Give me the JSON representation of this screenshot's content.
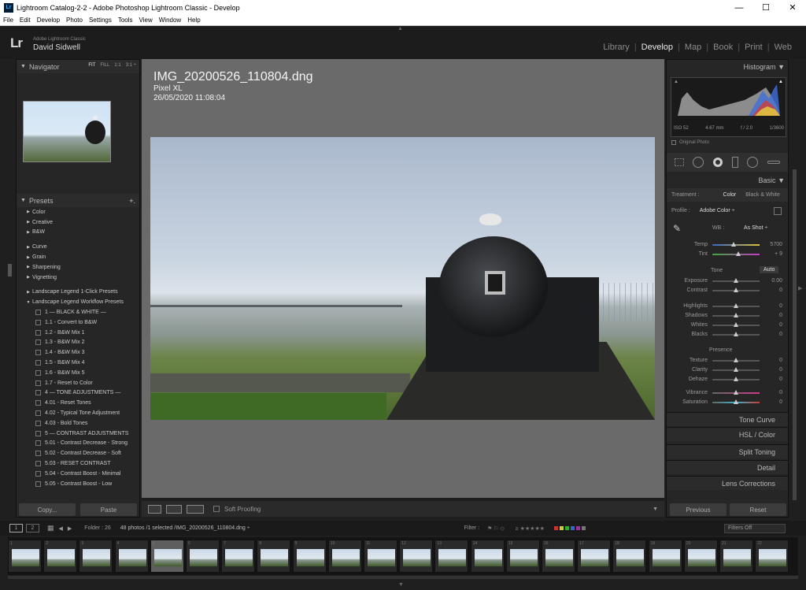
{
  "window": {
    "title": "Lightroom Catalog-2-2 - Adobe Photoshop Lightroom Classic - Develop",
    "app_icon": "Lr"
  },
  "menu": [
    "File",
    "Edit",
    "Develop",
    "Photo",
    "Settings",
    "Tools",
    "View",
    "Window",
    "Help"
  ],
  "identity": {
    "logo": "Lr",
    "product": "Adobe Lightroom Classic",
    "user": "David Sidwell"
  },
  "modules": [
    "Library",
    "Develop",
    "Map",
    "Book",
    "Print",
    "Web"
  ],
  "active_module": "Develop",
  "navigator": {
    "title": "Navigator",
    "zoom": [
      "FIT",
      "FILL",
      "1:1",
      "3:1 ÷"
    ]
  },
  "presets": {
    "title": "Presets",
    "add": "+.",
    "groups_top": [
      "Color",
      "Creative",
      "B&W"
    ],
    "groups_mid": [
      "Curve",
      "Grain",
      "Sharpening",
      "Vignetting"
    ],
    "groups_bottom": [
      "Landscape Legend 1-Click Presets",
      "Landscape Legend Workflow Presets"
    ],
    "items": [
      "1 — BLACK & WHITE —",
      "1.1 - Convert to B&W",
      "1.2 - B&W Mix 1",
      "1.3 - B&W Mix 2",
      "1.4 - B&W Mix 3",
      "1.5 - B&W Mix 4",
      "1.6 - B&W Mix 5",
      "1.7 - Reset to Color",
      "4 — TONE ADJUSTMENTS —",
      "4.01 - Reset Tones",
      "4.02 - Typical Tone Adjustment",
      "4.03 - Bold Tones",
      "5 — CONTRAST ADJUSTMENTS",
      "5.01 - Contrast Decrease - Strong",
      "5.02 - Contrast Decrease - Soft",
      "5.03 - RESET CONTRAST",
      "5.04 - Contrast Boost - Minimal",
      "5.05 - Contrast Boost - Low"
    ]
  },
  "left_buttons": {
    "copy": "Copy...",
    "paste": "Paste"
  },
  "photo_info": {
    "filename": "IMG_20200526_110804.dng",
    "camera": "Pixel XL",
    "datetime": "26/05/2020 11:08:04"
  },
  "toolbar": {
    "soft_proofing": "Soft Proofing"
  },
  "histogram": {
    "title": "Histogram",
    "iso": "ISO 52",
    "focal": "4.67 mm",
    "aperture": "f / 2.0",
    "shutter": "1/3600",
    "original_photo": "Original Photo"
  },
  "basic": {
    "title": "Basic",
    "treatment_label": "Treatment :",
    "treatment_color": "Color",
    "treatment_bw": "Black & White",
    "profile_label": "Profile :",
    "profile_value": "Adobe Color ÷",
    "wb_label": "WB :",
    "wb_value": "As Shot ÷",
    "tone_label": "Tone",
    "auto": "Auto",
    "presence_label": "Presence",
    "sliders": [
      {
        "label": "Temp",
        "value": "5700",
        "pos": 0.45
      },
      {
        "label": "Tint",
        "value": "+ 9",
        "pos": 0.55
      },
      {
        "label": "Exposure",
        "value": "0.00",
        "pos": 0.5
      },
      {
        "label": "Contrast",
        "value": "0",
        "pos": 0.5
      },
      {
        "label": "Highlights",
        "value": "0",
        "pos": 0.5
      },
      {
        "label": "Shadows",
        "value": "0",
        "pos": 0.5
      },
      {
        "label": "Whites",
        "value": "0",
        "pos": 0.5
      },
      {
        "label": "Blacks",
        "value": "0",
        "pos": 0.5
      },
      {
        "label": "Texture",
        "value": "0",
        "pos": 0.5
      },
      {
        "label": "Clarity",
        "value": "0",
        "pos": 0.5
      },
      {
        "label": "Dehaze",
        "value": "0",
        "pos": 0.5
      },
      {
        "label": "Vibrance",
        "value": "0",
        "pos": 0.5
      },
      {
        "label": "Saturation",
        "value": "0",
        "pos": 0.5
      }
    ]
  },
  "sections": [
    "Tone Curve",
    "HSL / Color",
    "Split Toning",
    "Detail",
    "Lens Corrections"
  ],
  "right_buttons": {
    "previous": "Previous",
    "reset": "Reset"
  },
  "filmstrip": {
    "folder": "Folder : 26",
    "count": "48 photos /1 selected /IMG_20200526_110804.dng ÷",
    "filter_label": "Filter :",
    "filters_off": "Filters Off",
    "page1": "1",
    "page2": "2",
    "numbers": [
      "1",
      "2",
      "3",
      "4",
      "5",
      "6",
      "7",
      "8",
      "9",
      "10",
      "11",
      "12",
      "13",
      "14",
      "15",
      "16",
      "17",
      "18",
      "19",
      "20",
      "21",
      "22"
    ],
    "selected_index": 4
  }
}
